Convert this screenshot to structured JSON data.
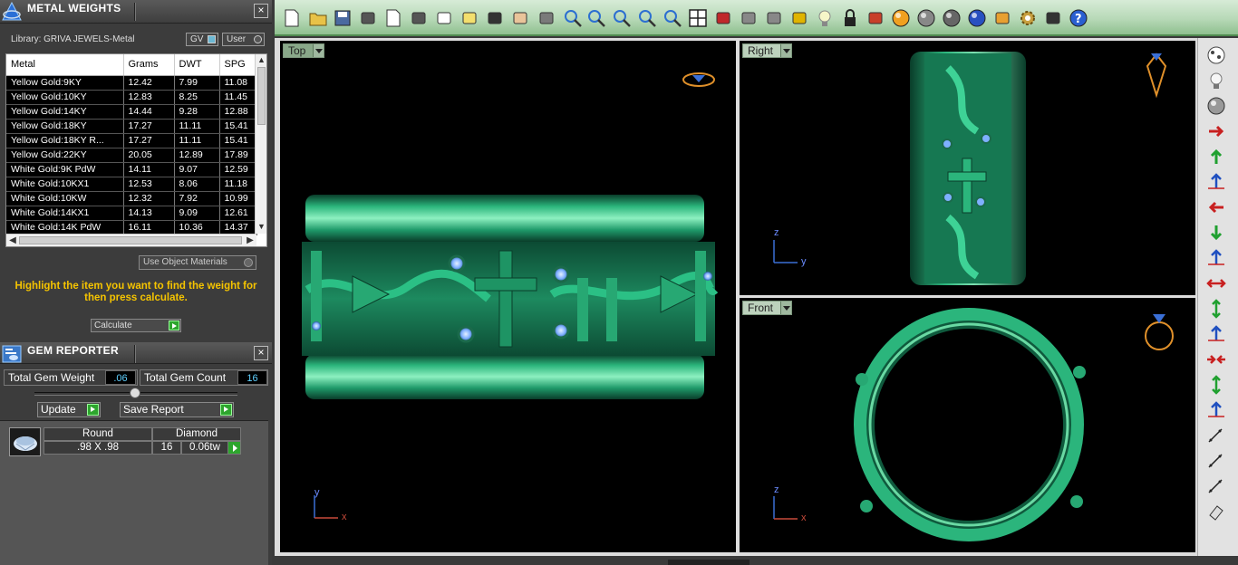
{
  "metal_weights": {
    "title": "METAL WEIGHTS",
    "close": "×",
    "library": "Library: GRIVA JEWELS-Metal",
    "toggle_gv": "GV",
    "toggle_user": "User",
    "columns": [
      "Metal",
      "Grams",
      "DWT",
      "SPG"
    ],
    "rows": [
      [
        "Yellow Gold:9KY",
        "12.42",
        "7.99",
        "11.08"
      ],
      [
        "Yellow Gold:10KY",
        "12.83",
        "8.25",
        "11.45"
      ],
      [
        "Yellow Gold:14KY",
        "14.44",
        "9.28",
        "12.88"
      ],
      [
        "Yellow Gold:18KY",
        "17.27",
        "11.11",
        "15.41"
      ],
      [
        "Yellow Gold:18KY R...",
        "17.27",
        "11.11",
        "15.41"
      ],
      [
        "Yellow Gold:22KY",
        "20.05",
        "12.89",
        "17.89"
      ],
      [
        "White Gold:9K PdW",
        "14.11",
        "9.07",
        "12.59"
      ],
      [
        "White Gold:10KX1",
        "12.53",
        "8.06",
        "11.18"
      ],
      [
        "White Gold:10KW",
        "12.32",
        "7.92",
        "10.99"
      ],
      [
        "White Gold:14KX1",
        "14.13",
        "9.09",
        "12.61"
      ],
      [
        "White Gold:14K PdW",
        "16.11",
        "10.36",
        "14.37"
      ]
    ],
    "use_object_materials": "Use Object Materials",
    "hint": "Highlight the item you want to find the weight for then press calculate.",
    "calculate": "Calculate"
  },
  "gem_reporter": {
    "title": "GEM REPORTER",
    "close": "×",
    "total_weight_label": "Total Gem Weight",
    "total_weight_value": ".06",
    "total_count_label": "Total Gem Count",
    "total_count_value": "16",
    "update": "Update",
    "save_report": "Save Report",
    "gem": {
      "shape": "Round",
      "type": "Diamond",
      "size": ".98 X .98",
      "count": "16",
      "weight": "0.06tw"
    }
  },
  "viewports": {
    "top": {
      "label": "Top",
      "axis_v": "y",
      "axis_h": "x"
    },
    "right": {
      "label": "Right",
      "axis_v": "z",
      "axis_h": "y"
    },
    "front": {
      "label": "Front",
      "axis_v": "z",
      "axis_h": "x"
    }
  },
  "colors": {
    "model_green": "#1f9a6a",
    "gem_blue": "#7fb0ff",
    "toolbar_green": "#b7d9b7",
    "hint_yellow": "#f5c400"
  },
  "toolbar_icons": [
    "new-icon",
    "open-icon",
    "save-icon",
    "print-icon",
    "export-icon",
    "cut-icon",
    "copy-icon",
    "paste-icon",
    "undo-icon",
    "pan-hand-icon",
    "rotate-view-icon",
    "zoom-icon",
    "zoom-window-icon",
    "zoom-extents-icon",
    "zoom-selected-icon",
    "zoom-dynamic-icon",
    "four-views-icon",
    "car-icon",
    "eye-icon",
    "snap-circle-icon",
    "grid-snap-icon",
    "light-bulb-icon",
    "lock-icon",
    "book-icon",
    "color-wheel-icon",
    "render-sphere-icon",
    "shaded-sphere-icon",
    "blue-sphere-icon",
    "cone-light-icon",
    "gear-icon",
    "dimension-icon",
    "help-icon"
  ],
  "right_tool_icons": [
    "view-cube-icon",
    "light-bulb-icon",
    "sphere-icon",
    "move-right-icon",
    "move-up-icon",
    "align-up-icon",
    "move-left-icon",
    "move-down-icon",
    "align-down-icon",
    "scale-horizontal-icon",
    "scale-vertical-icon",
    "align-vertical-icon",
    "shrink-horizontal-icon",
    "stretch-vertical-icon",
    "align-center-icon",
    "curve-tool-icon",
    "line-tool-icon",
    "line-tool-2-icon",
    "eraser-icon"
  ]
}
